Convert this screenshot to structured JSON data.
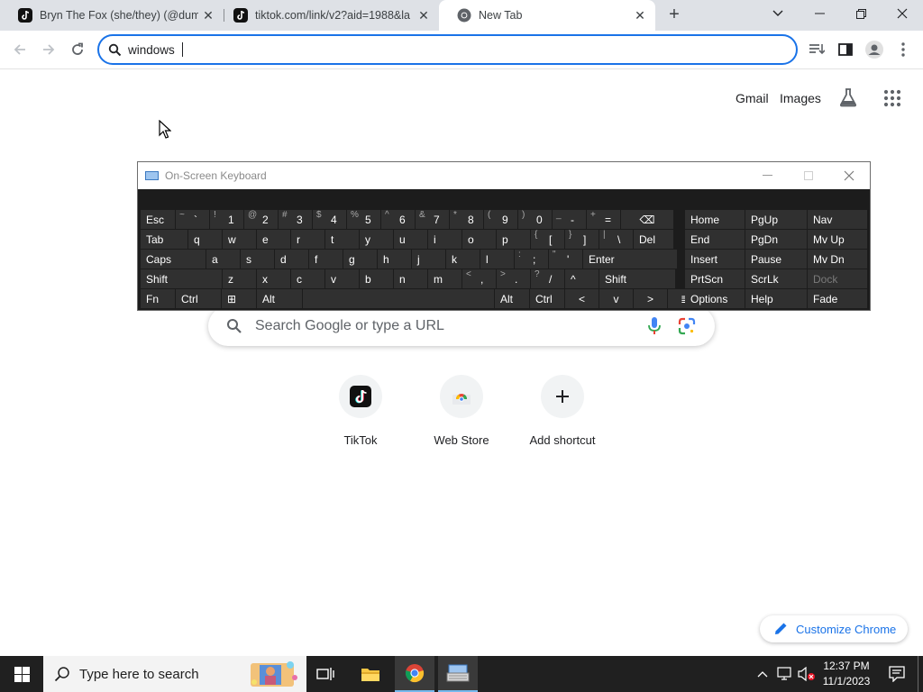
{
  "browser": {
    "tabs": [
      {
        "title": "Bryn The Fox (she/they) (@dumb",
        "favicon": "tiktok-icon",
        "active": false
      },
      {
        "title": "tiktok.com/link/v2?aid=1988&la",
        "favicon": "tiktok-icon",
        "active": false
      },
      {
        "title": "New Tab",
        "favicon": "chrome-icon",
        "active": true
      }
    ],
    "address_bar": {
      "value": "windows "
    }
  },
  "ntp": {
    "gmail_label": "Gmail",
    "images_label": "Images",
    "search_placeholder": "Search Google or type a URL",
    "shortcuts": [
      {
        "label": "TikTok",
        "icon": "tiktok-icon"
      },
      {
        "label": "Web Store",
        "icon": "chrome-web-store-icon"
      },
      {
        "label": "Add shortcut",
        "icon": "plus-icon"
      }
    ],
    "customize_label": "Customize Chrome"
  },
  "osk": {
    "title": "On-Screen Keyboard",
    "row1": [
      {
        "main": "Esc"
      },
      {
        "shift": "~",
        "main": "`"
      },
      {
        "shift": "!",
        "main": "1"
      },
      {
        "shift": "@",
        "main": "2"
      },
      {
        "shift": "#",
        "main": "3"
      },
      {
        "shift": "$",
        "main": "4"
      },
      {
        "shift": "%",
        "main": "5"
      },
      {
        "shift": "^",
        "main": "6"
      },
      {
        "shift": "&",
        "main": "7"
      },
      {
        "shift": "*",
        "main": "8"
      },
      {
        "shift": "(",
        "main": "9"
      },
      {
        "shift": ")",
        "main": "0"
      },
      {
        "shift": "_",
        "main": "-"
      },
      {
        "shift": "+",
        "main": "="
      },
      {
        "main": "⌫"
      }
    ],
    "row2": [
      "Tab",
      "q",
      "w",
      "e",
      "r",
      "t",
      "y",
      "u",
      "i",
      "o",
      "p",
      "[",
      "]",
      "\\",
      "Del"
    ],
    "row2_shift": {
      "[": "{",
      "]": "}",
      "\\": "|"
    },
    "row3": [
      "Caps",
      "a",
      "s",
      "d",
      "f",
      "g",
      "h",
      "j",
      "k",
      "l",
      ";",
      "'",
      "Enter"
    ],
    "row3_shift": {
      ";": ":",
      "'": "\""
    },
    "row4": [
      "Shift",
      "z",
      "x",
      "c",
      "v",
      "b",
      "n",
      "m",
      ",",
      ".",
      "/",
      "^",
      "Shift"
    ],
    "row4_shift": {
      ",": "<",
      ".": ">",
      "/": "?"
    },
    "row5": [
      "Fn",
      "Ctrl",
      "⊞",
      "Alt",
      "",
      "Alt",
      "Ctrl",
      "<",
      "v",
      ">",
      "≣"
    ],
    "nav_keys": [
      [
        "Home",
        "PgUp",
        "Nav"
      ],
      [
        "End",
        "PgDn",
        "Mv Up"
      ],
      [
        "Insert",
        "Pause",
        "Mv Dn"
      ],
      [
        "PrtScn",
        "ScrLk",
        "Dock"
      ],
      [
        "Options",
        "Help",
        "Fade"
      ]
    ]
  },
  "taskbar": {
    "search_placeholder": "Type here to search",
    "time": "12:37 PM",
    "date": "11/1/2023"
  },
  "colors": {
    "accent": "#1a73e8",
    "tabstrip": "#dee1e6",
    "osk_bg": "#1c1c1c",
    "osk_key": "#303030",
    "taskbar": "#202020"
  }
}
